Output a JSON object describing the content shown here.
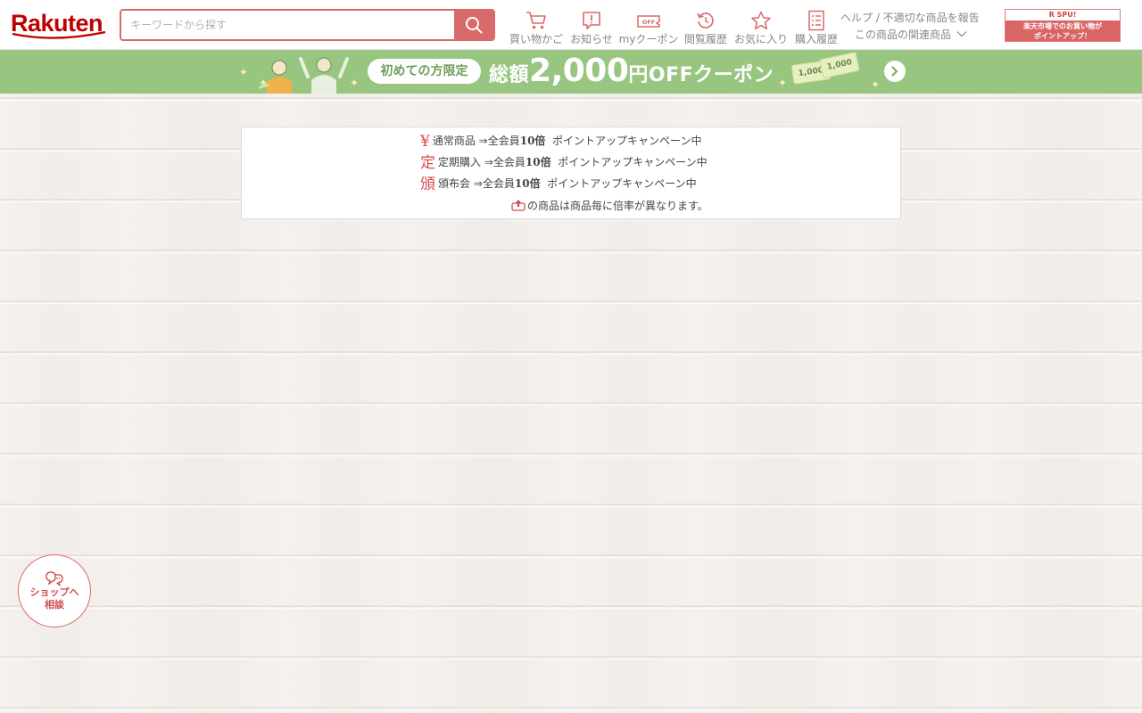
{
  "header": {
    "logo_text": "Rakuten",
    "search": {
      "placeholder": "キーワードから探す",
      "value": ""
    },
    "nav": [
      {
        "label": "買い物かご",
        "icon": "cart-icon"
      },
      {
        "label": "お知らせ",
        "icon": "notice-icon"
      },
      {
        "label": "myクーポン",
        "icon": "coupon-icon"
      },
      {
        "label": "閲覧履歴",
        "icon": "history-icon"
      },
      {
        "label": "お気に入り",
        "icon": "star-icon"
      },
      {
        "label": "購入履歴",
        "icon": "receipt-icon"
      }
    ],
    "help": {
      "line1": "ヘルプ / 不適切な商品を報告",
      "line2": "この商品の関連商品"
    },
    "spu": {
      "top": "R SPU!",
      "line1": "楽天市場でのお買い物が",
      "line2": "ポイントアップ！"
    },
    "coupon_icon_text": "OFF"
  },
  "banner": {
    "pill": "初めての方限定",
    "prefix": "総額",
    "amount": "2,000",
    "suffix": "円OFFクーポン",
    "ticket1": "1,000",
    "ticket2": "1,000"
  },
  "campaign": {
    "rows": [
      {
        "glyph": "¥",
        "name": "通常商品",
        "arrow": " ⇒全会員",
        "mult": "10倍",
        "tail": "  ポイントアップキャンペーン中"
      },
      {
        "glyph": "定",
        "name": "定期購入",
        "arrow": " ⇒全会員",
        "mult": "10倍",
        "tail": "  ポイントアップキャンペーン中"
      },
      {
        "glyph": "頒",
        "name": "頒布会",
        "arrow": " ⇒全会員",
        "mult": "10倍",
        "tail": "  ポイントアップキャンペーン中"
      }
    ],
    "note": "の商品は商品毎に倍率が異なります。"
  },
  "chat": {
    "line1": "ショップへ",
    "line2": "相談"
  },
  "colors": {
    "brand": "#bf0000",
    "accent": "#d96a6a",
    "banner": "#98c580"
  }
}
